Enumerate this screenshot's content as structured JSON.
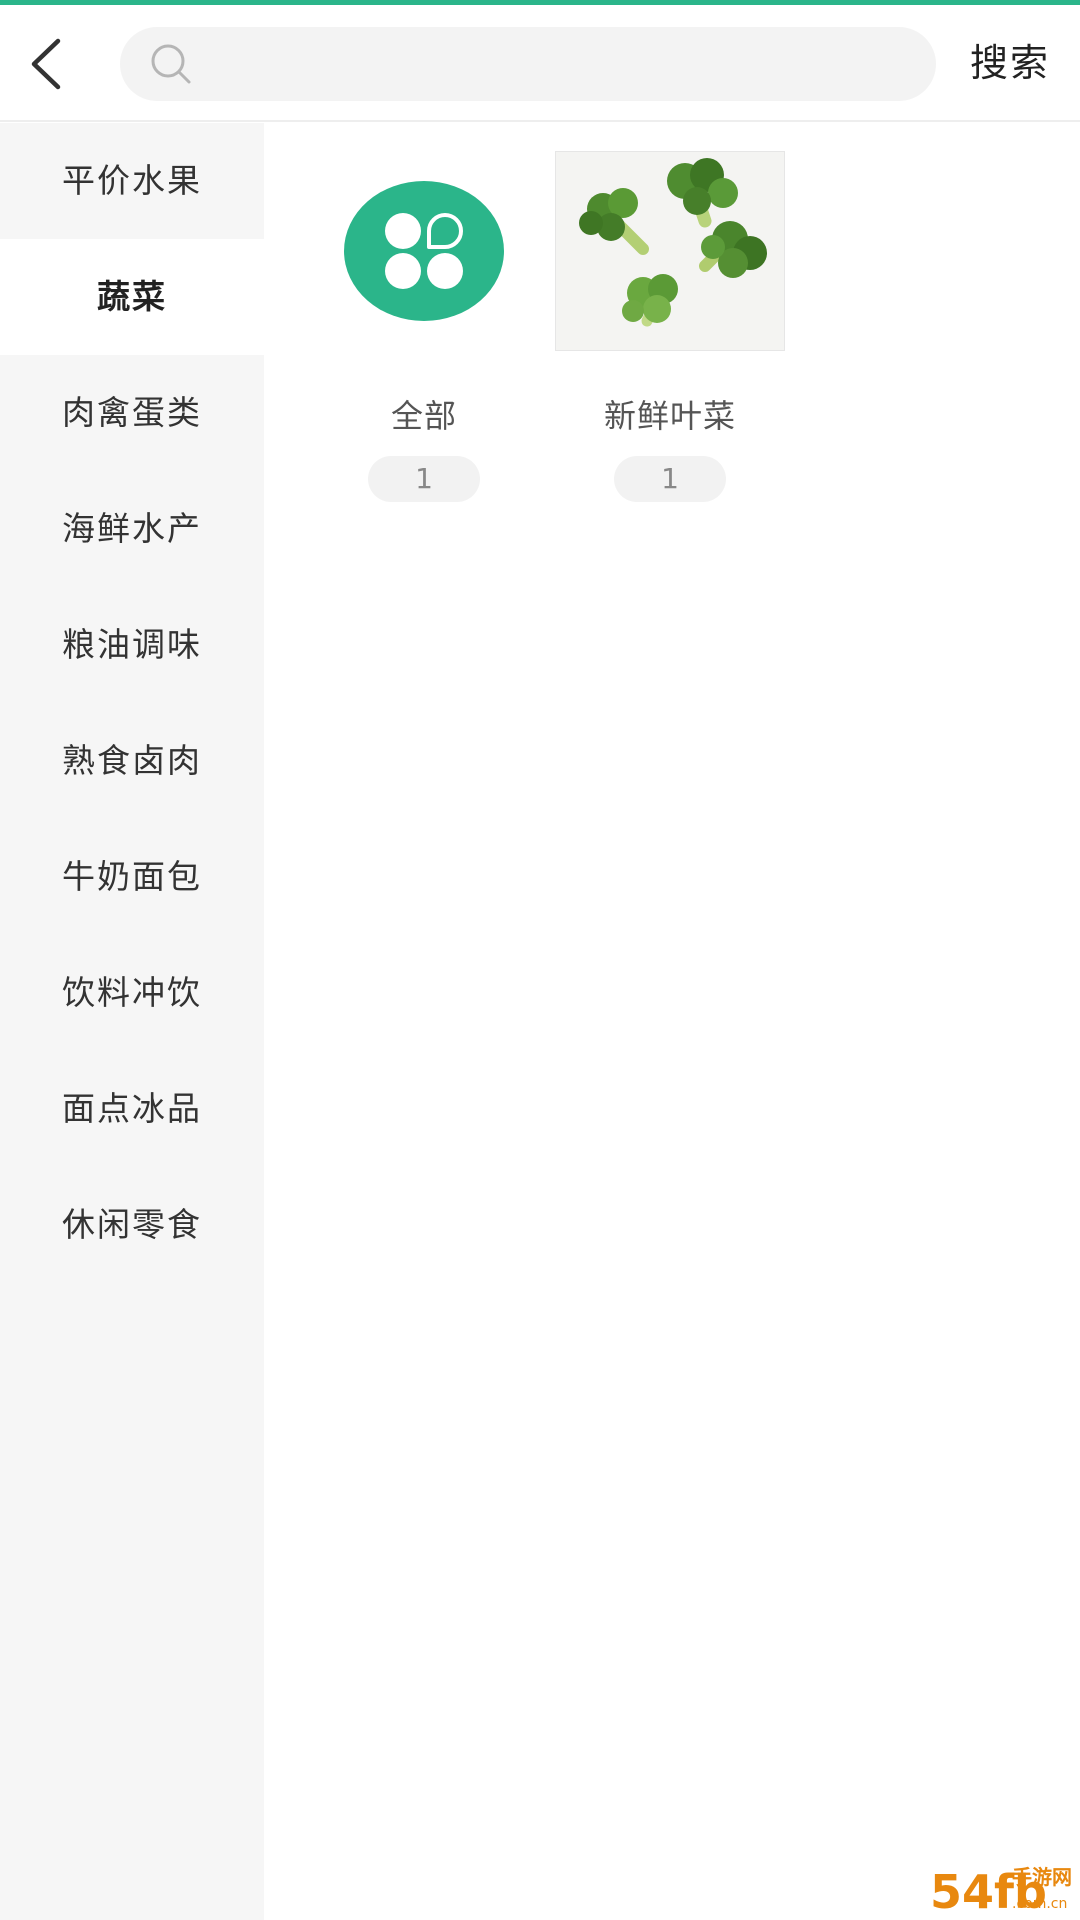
{
  "header": {
    "search_placeholder": "",
    "search_value": "",
    "search_button_label": "搜索"
  },
  "sidebar": {
    "active_index": 1,
    "items": [
      {
        "label": "平价水果"
      },
      {
        "label": "蔬菜"
      },
      {
        "label": "肉禽蛋类"
      },
      {
        "label": "海鲜水产"
      },
      {
        "label": "粮油调味"
      },
      {
        "label": "熟食卤肉"
      },
      {
        "label": "牛奶面包"
      },
      {
        "label": "饮料冲饮"
      },
      {
        "label": "面点冰品"
      },
      {
        "label": "休闲零食"
      }
    ]
  },
  "subcategories": [
    {
      "name": "全部",
      "count": "1",
      "icon": "all-categories-icon"
    },
    {
      "name": "新鲜叶菜",
      "count": "1",
      "icon": "broccoli-image"
    }
  ],
  "watermark": {
    "brand": "54fb",
    "site_name": "手游网",
    "domain": ".com.cn"
  },
  "colors": {
    "accent": "#2bb58a",
    "sidebar_bg": "#f6f6f6",
    "watermark": "#e8880f"
  }
}
